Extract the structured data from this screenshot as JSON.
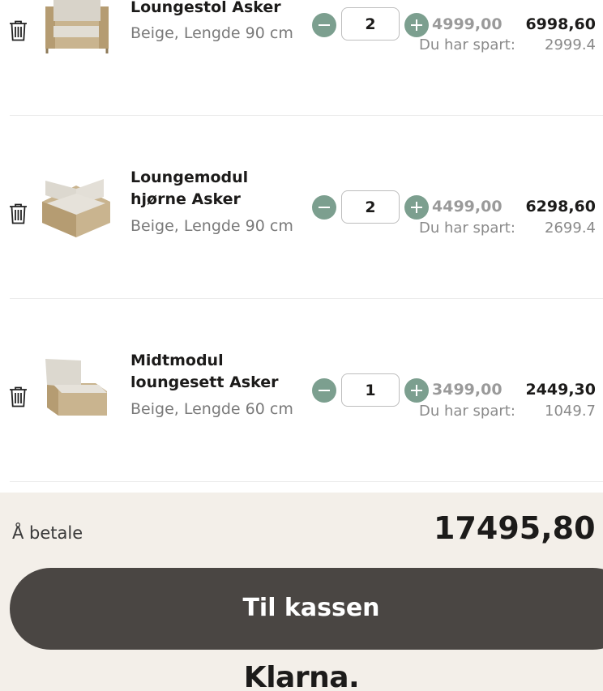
{
  "cart": {
    "items": [
      {
        "name": "Loungestol Asker",
        "variant": "Beige, Lengde 90 cm",
        "quantity": "2",
        "unit_price": "4999,00",
        "line_total": "6998,60",
        "saved_label": "Du har spart:",
        "saved_value": "2999.4",
        "image": "lounge-chair-image"
      },
      {
        "name": "Loungemodul hjørne Asker",
        "variant": "Beige, Lengde 90 cm",
        "quantity": "2",
        "unit_price": "4499,00",
        "line_total": "6298,60",
        "saved_label": "Du har spart:",
        "saved_value": "2699.4",
        "image": "corner-module-image"
      },
      {
        "name": "Midtmodul loungesett Asker",
        "variant": "Beige, Lengde 60 cm",
        "quantity": "1",
        "unit_price": "3499,00",
        "line_total": "2449,30",
        "saved_label": "Du har spart:",
        "saved_value": "1049.7",
        "image": "middle-module-image"
      }
    ],
    "icons": {
      "delete": "trash-icon",
      "decrease": "minus-icon",
      "increase": "plus-icon"
    }
  },
  "summary": {
    "pay_label": "Å betale",
    "pay_total": "17495,80 kr",
    "checkout_label": "Til kassen",
    "payment_logo": "Klarna."
  },
  "colors": {
    "qty_button": "#7c9f8f",
    "checkout_button": "#4a4643",
    "summary_background": "#f3efe9"
  }
}
